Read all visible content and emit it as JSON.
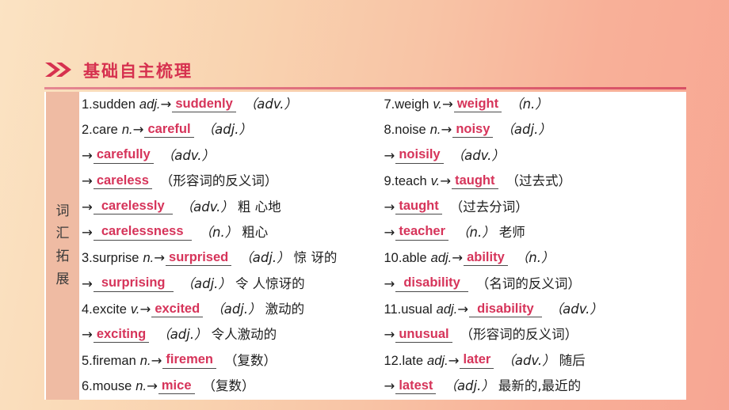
{
  "header": {
    "icon": "double-chevron-right-icon",
    "title": "基础自主梳理",
    "accent_color": "#D6314F"
  },
  "card": {
    "side_label_chars": [
      "词",
      "汇",
      "拓",
      "展"
    ],
    "side_label_text": "词汇拓展",
    "side_bg": "#EFBBA3",
    "answer_color": "#D6345A",
    "background": "#FFFFFF"
  },
  "columns": {
    "left": [
      {
        "num": "1.",
        "word": "sudden",
        "pos": "adj.",
        "arrow": "→",
        "answer": "suddenly",
        "tail": "（adv.）",
        "note": ""
      },
      {
        "num": "2.",
        "word": "care",
        "pos": "n.",
        "arrow": "→",
        "answer": "careful",
        "tail": "（adj.）",
        "note": ""
      },
      {
        "num": "",
        "word": "",
        "pos": "",
        "arrow": "→",
        "answer": "carefully",
        "tail": "（adv.）",
        "note": ""
      },
      {
        "num": "",
        "word": "",
        "pos": "",
        "arrow": "→",
        "answer": "careless",
        "tail": "（形容词的反义词）",
        "note": ""
      },
      {
        "num": "",
        "word": "",
        "pos": "",
        "arrow": "→",
        "answer": "carelessly",
        "tail": "（adv.）",
        "note": "粗 心地"
      },
      {
        "num": "",
        "word": "",
        "pos": "",
        "arrow": "→",
        "answer": "carelessness",
        "tail": "（n.）",
        "note": "粗心"
      },
      {
        "num": "3.",
        "word": "surprise",
        "pos": "n.",
        "arrow": "→",
        "answer": "surprised",
        "tail": "（adj.）",
        "note": "惊 讶的"
      },
      {
        "num": "",
        "word": "",
        "pos": "",
        "arrow": "→",
        "answer": "surprising",
        "tail": "（adj.）",
        "note": "令 人惊讶的"
      },
      {
        "num": "4.",
        "word": "excite",
        "pos": "v.",
        "arrow": "→",
        "answer": "excited",
        "tail": "（adj.）",
        "note": "激动的"
      },
      {
        "num": "",
        "word": "",
        "pos": "",
        "arrow": "→",
        "answer": "exciting",
        "tail": "（adj.）",
        "note": "令人激动的"
      },
      {
        "num": "5.",
        "word": "fireman",
        "pos": "n.",
        "arrow": "→",
        "answer": "firemen",
        "tail": "（复数）",
        "note": ""
      },
      {
        "num": "6.",
        "word": "mouse",
        "pos": "n.",
        "arrow": "→",
        "answer": "mice",
        "tail": "（复数）",
        "note": ""
      }
    ],
    "right": [
      {
        "num": "7.",
        "word": "weigh",
        "pos": "v.",
        "arrow": "→",
        "answer": "weight",
        "tail": "（n.）",
        "note": ""
      },
      {
        "num": "8.",
        "word": "noise",
        "pos": "n.",
        "arrow": "→",
        "answer": "noisy",
        "tail": "（adj.）",
        "note": ""
      },
      {
        "num": "",
        "word": "",
        "pos": "",
        "arrow": "→",
        "answer": "noisily",
        "tail": "（adv.）",
        "note": ""
      },
      {
        "num": "9.",
        "word": "teach",
        "pos": "v.",
        "arrow": "→",
        "answer": "taught",
        "tail": "（过去式）",
        "note": ""
      },
      {
        "num": "",
        "word": "",
        "pos": "",
        "arrow": "→",
        "answer": "taught",
        "tail": "（过去分词）",
        "note": ""
      },
      {
        "num": "",
        "word": "",
        "pos": "",
        "arrow": "→",
        "answer": "teacher",
        "tail": "（n.）",
        "note": "老师"
      },
      {
        "num": "10.",
        "word": "able",
        "pos": "adj.",
        "arrow": "→",
        "answer": "ability",
        "tail": "（n.）",
        "note": ""
      },
      {
        "num": "",
        "word": "",
        "pos": "",
        "arrow": "→",
        "answer": "disability",
        "tail": "（名词的反义词）",
        "note": ""
      },
      {
        "num": "11.",
        "word": "usual",
        "pos": "adj.",
        "arrow": "→",
        "answer": "disability",
        "tail": "（adv.）",
        "note": ""
      },
      {
        "num": "",
        "word": "",
        "pos": "",
        "arrow": "→",
        "answer": "unusual",
        "tail": "（形容词的反义词）",
        "note": ""
      },
      {
        "num": "12.",
        "word": "late",
        "pos": "adj.",
        "arrow": "→",
        "answer": "later",
        "tail": "（adv.）",
        "note": "随后"
      },
      {
        "num": "",
        "word": "",
        "pos": "",
        "arrow": "→",
        "answer": "latest",
        "tail": "（adj.）",
        "note": "最新的,最近的"
      }
    ]
  }
}
